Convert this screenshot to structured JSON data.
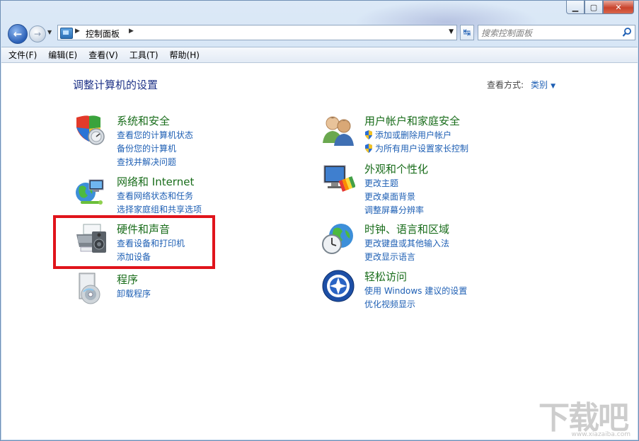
{
  "nav": {
    "breadcrumb": "控制面板",
    "search_placeholder": "搜索控制面板"
  },
  "menu": [
    "文件(F)",
    "编辑(E)",
    "查看(V)",
    "工具(T)",
    "帮助(H)"
  ],
  "page": {
    "title": "调整计算机的设置",
    "view_by_label": "查看方式:",
    "view_by_value": "类别"
  },
  "categories": {
    "system": {
      "title": "系统和安全",
      "links": [
        "查看您的计算机状态",
        "备份您的计算机",
        "查找并解决问题"
      ]
    },
    "network": {
      "title": "网络和 Internet",
      "links": [
        "查看网络状态和任务",
        "选择家庭组和共享选项"
      ]
    },
    "hardware": {
      "title": "硬件和声音",
      "links": [
        "查看设备和打印机",
        "添加设备"
      ]
    },
    "programs": {
      "title": "程序",
      "links": [
        "卸载程序"
      ]
    },
    "users": {
      "title": "用户帐户和家庭安全",
      "links": [
        "添加或删除用户帐户",
        "为所有用户设置家长控制"
      ]
    },
    "appearance": {
      "title": "外观和个性化",
      "links": [
        "更改主题",
        "更改桌面背景",
        "调整屏幕分辨率"
      ]
    },
    "clock": {
      "title": "时钟、语言和区域",
      "links": [
        "更改键盘或其他输入法",
        "更改显示语言"
      ]
    },
    "access": {
      "title": "轻松访问",
      "links": [
        "使用 Windows 建议的设置",
        "优化视频显示"
      ]
    }
  },
  "watermark": {
    "text": "下载吧",
    "url": "www.xiazaiba.com"
  },
  "colors": {
    "category_title": "#186c1a",
    "link": "#1e5fb4",
    "page_title": "#1e3287",
    "highlight": "#e0141b"
  }
}
